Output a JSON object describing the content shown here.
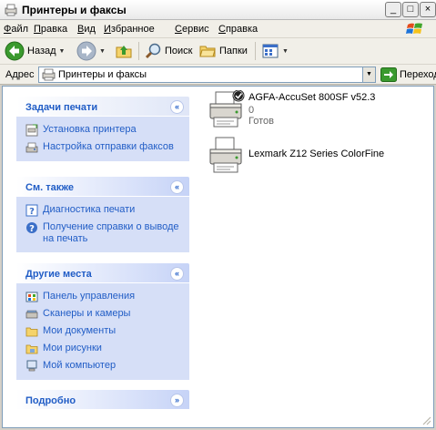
{
  "window": {
    "title": "Принтеры и факсы"
  },
  "menu": [
    {
      "label_u": "Ф",
      "label_rest": "айл"
    },
    {
      "label_u": "П",
      "label_rest": "равка"
    },
    {
      "label_u": "В",
      "label_rest": "ид"
    },
    {
      "label_u": "И",
      "label_rest": "збранное"
    },
    {
      "label_u": "С",
      "label_rest": "ервис"
    },
    {
      "label_u": "С",
      "label_rest": "правка"
    }
  ],
  "toolbar": {
    "back_label": "Назад",
    "search_label": "Поиск",
    "folders_label": "Папки"
  },
  "address": {
    "label": "Адрес",
    "value": "Принтеры и факсы",
    "go_label": "Переход"
  },
  "panels": [
    {
      "title": "Задачи печати",
      "chevron": "«",
      "items": [
        {
          "label": "Установка принтера",
          "icon": "add-printer-icon"
        },
        {
          "label": "Настройка отправки факсов",
          "icon": "fax-icon"
        }
      ]
    },
    {
      "title": "См. также",
      "chevron": "«",
      "items": [
        {
          "label": "Диагностика печати",
          "icon": "help-icon"
        },
        {
          "label": "Получение справки о выводе на печать",
          "icon": "help-icon"
        }
      ]
    },
    {
      "title": "Другие места",
      "chevron": "«",
      "items": [
        {
          "label": "Панель управления",
          "icon": "control-panel-icon"
        },
        {
          "label": "Сканеры и камеры",
          "icon": "scanner-icon"
        },
        {
          "label": "Мои документы",
          "icon": "folder-icon"
        },
        {
          "label": "Мои рисунки",
          "icon": "folder-icon"
        },
        {
          "label": "Мой компьютер",
          "icon": "computer-icon"
        }
      ]
    },
    {
      "title": "Подробно",
      "chevron": "»",
      "items": []
    }
  ],
  "printers": [
    {
      "name": "AGFA-AccuSet 800SF v52.3",
      "docs": "0",
      "status": "Готов",
      "default": true
    },
    {
      "name": "Lexmark Z12 Series ColorFine",
      "docs": "",
      "status": "",
      "default": false
    }
  ],
  "colors": {
    "link": "#215dc6",
    "panel_body": "#d6dff7",
    "address_border": "#7f9db9"
  }
}
